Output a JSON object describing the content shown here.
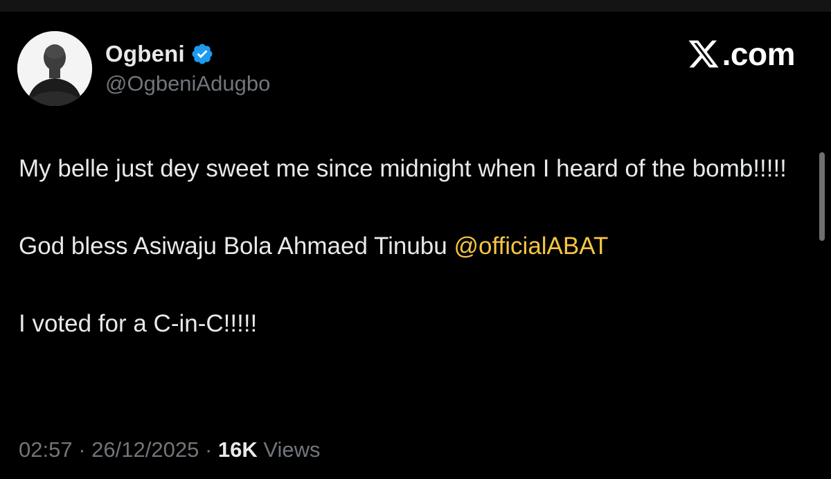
{
  "author": {
    "display_name": "Ogbeni",
    "handle": "@OgbeniAdugbo",
    "verified": true,
    "avatar_icon": "profile-photo"
  },
  "brand": {
    "icon": "x-logo-icon",
    "text": ".com"
  },
  "tweet": {
    "line1": "My belle just dey sweet me since midnight when I heard of the bomb!!!!!",
    "line2_prefix": "God bless Asiwaju Bola Ahmaed Tinubu ",
    "mention": "@officialABAT",
    "line3": "I voted for a C-in-C!!!!!"
  },
  "meta": {
    "time": "02:57",
    "separator": "·",
    "date": "26/12/2025",
    "views_count": "16K",
    "views_label": "Views"
  },
  "colors": {
    "background": "#000000",
    "text": "#e7e9ea",
    "muted": "#71767b",
    "mention": "#f5c542",
    "verified": "#1d9bf0"
  }
}
